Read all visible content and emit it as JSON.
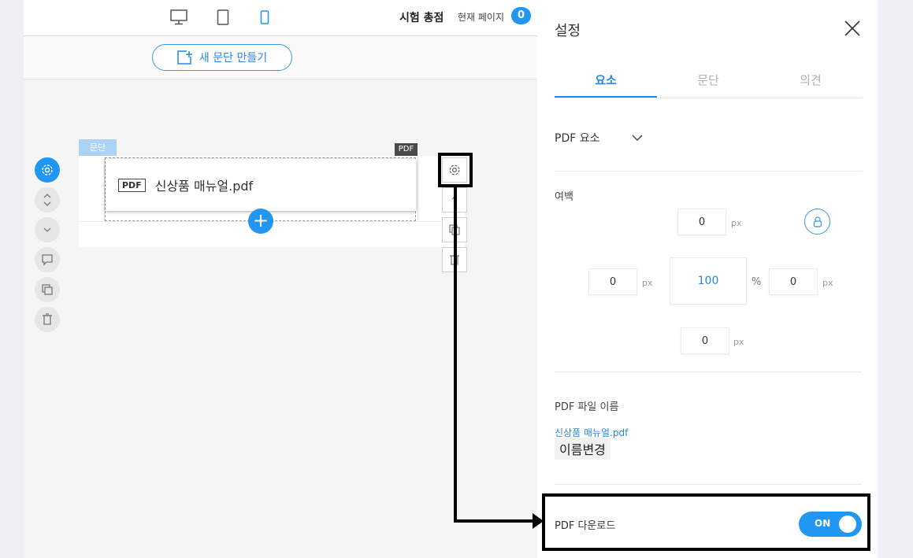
{
  "header": {
    "title": "시험 총점",
    "page_label": "현재 페이지",
    "page_count": "0"
  },
  "device_icons": [
    "desktop-icon",
    "tablet-icon",
    "mobile-icon"
  ],
  "new_section_button": "새 문단 만들기",
  "canvas": {
    "section_tag": "문단",
    "element_tag": "PDF",
    "pdf_badge": "PDF",
    "pdf_filename": "신상품 매뉴얼.pdf",
    "add_symbol": "+"
  },
  "panel": {
    "title": "설정",
    "tabs": [
      {
        "label": "요소",
        "active": true
      },
      {
        "label": "문단",
        "active": false
      },
      {
        "label": "의견",
        "active": false
      }
    ],
    "element_type": "PDF 요소",
    "margin": {
      "label": "여백",
      "top": "0",
      "left": "0",
      "center": "100",
      "right": "0",
      "bottom": "0",
      "unit_px": "px",
      "unit_pct": "%"
    },
    "file_name_label": "PDF 파일 이름",
    "file_name": "신상품 매뉴얼.pdf",
    "rename_button": "이름변경",
    "download_label": "PDF 다운로드",
    "download_toggle": "ON"
  },
  "colors": {
    "accent": "#2196f3",
    "link": "#2a86dc",
    "highlight": "#000000"
  }
}
